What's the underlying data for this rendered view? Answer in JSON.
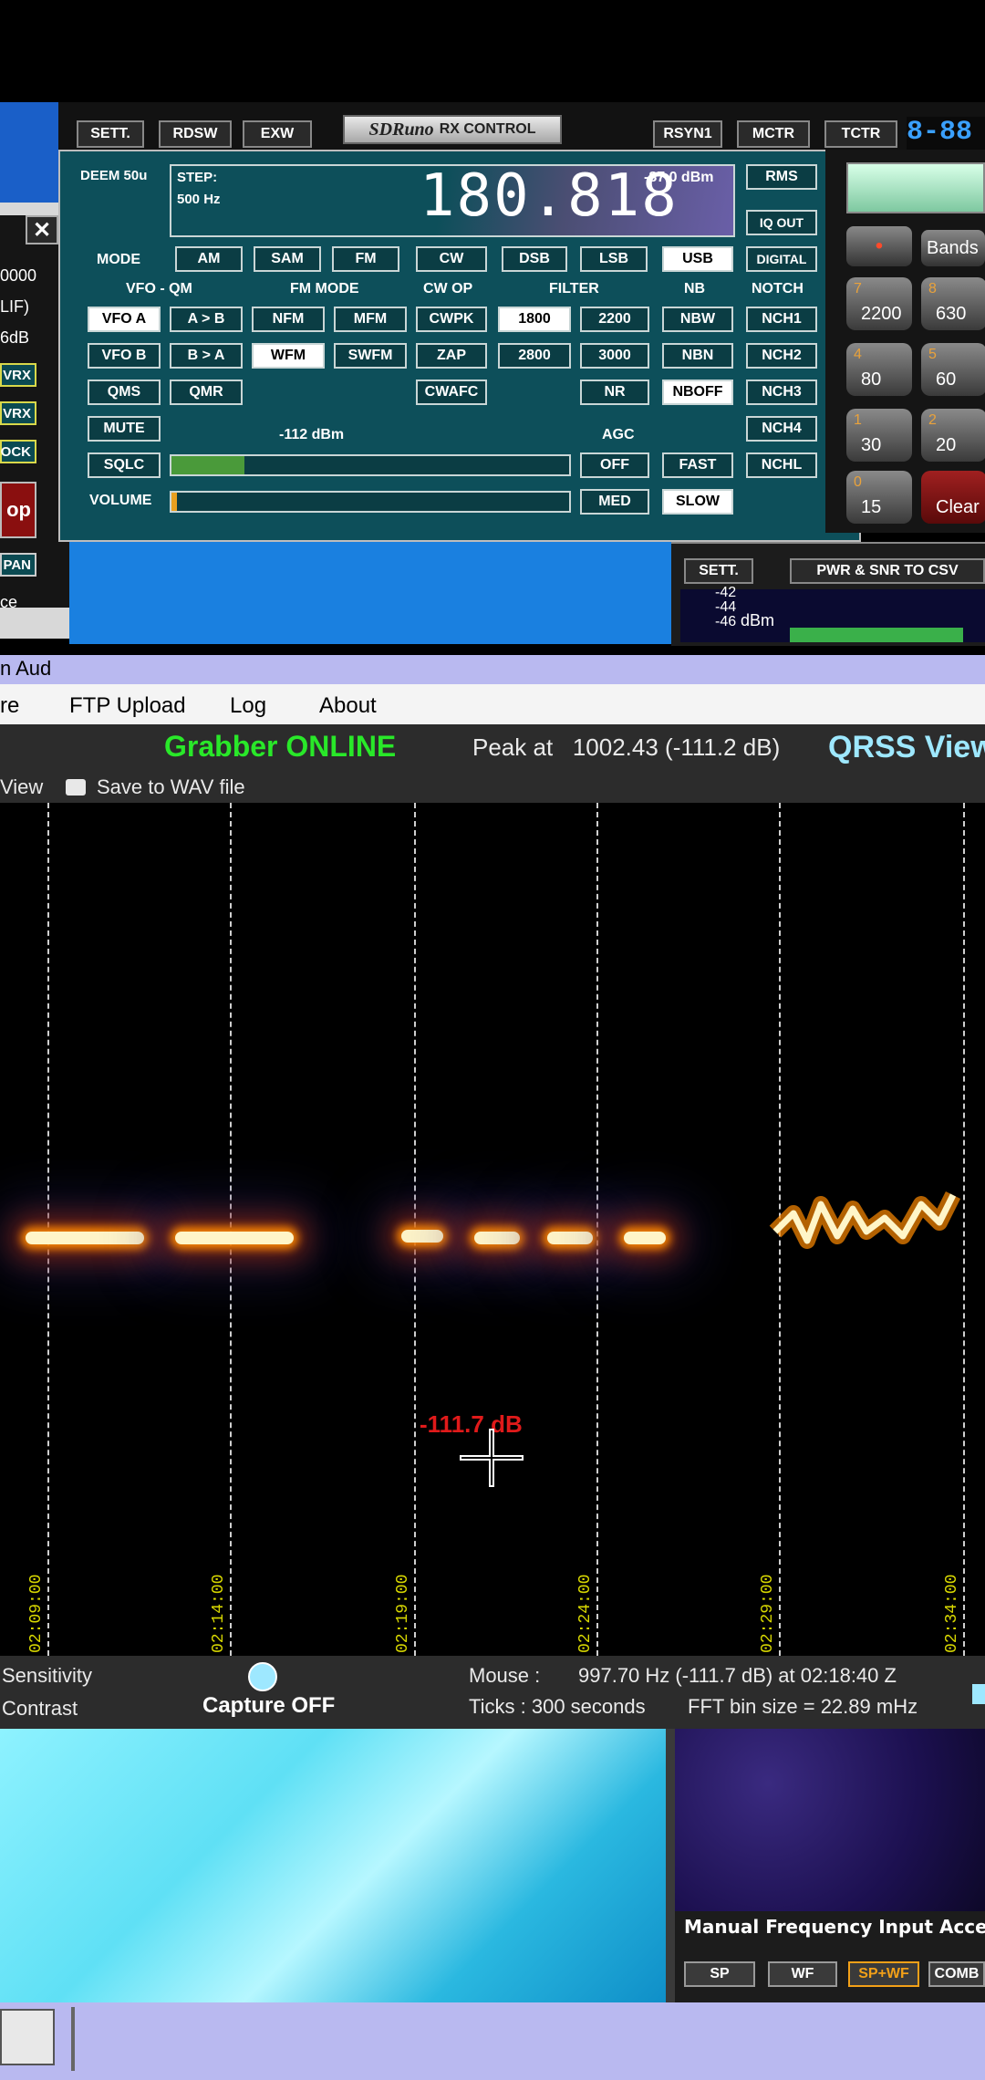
{
  "left_panel": {
    "items": [
      "0000",
      "LIF)",
      "6dB",
      "VRX",
      "VRX",
      "OCK",
      "op",
      "PAN",
      "ce"
    ],
    "close": "✕"
  },
  "sdr": {
    "top_buttons": [
      "SETT.",
      "RDSW",
      "EXW",
      "RSYN1",
      "MCTR",
      "TCTR"
    ],
    "logo": "SDRuno",
    "title": "RX CONTROL",
    "freq_readout_right": "8-88",
    "deem": "DEEM 50u",
    "step_label": "STEP:",
    "step_value": "500 Hz",
    "frequency": "180.818",
    "dbm": "-87.0 dBm",
    "rms": "RMS",
    "iq_out": "IQ OUT",
    "digital": "DIGITAL",
    "mode_label": "MODE",
    "modes": [
      "AM",
      "SAM",
      "FM",
      "CW",
      "DSB",
      "LSB",
      "USB"
    ],
    "section_labels": {
      "vfo": "VFO - QM",
      "fm_mode": "FM MODE",
      "cw_op": "CW OP",
      "filter": "FILTER",
      "nb": "NB",
      "notch": "NOTCH"
    },
    "row1": [
      "VFO A",
      "A > B",
      "NFM",
      "MFM",
      "CWPK",
      "1800",
      "2200",
      "NBW",
      "NCH1"
    ],
    "row2": [
      "VFO B",
      "B > A",
      "WFM",
      "SWFM",
      "ZAP",
      "2800",
      "3000",
      "NBN",
      "NCH2"
    ],
    "row3": [
      "QMS",
      "QMR",
      "CWAFC",
      "NR",
      "NBOFF",
      "NCH3"
    ],
    "row4": [
      "MUTE",
      "NCH4"
    ],
    "signal_level": "-112 dBm",
    "agc_label": "AGC",
    "sqlc": "SQLC",
    "agc1": [
      "OFF",
      "FAST",
      "NCHL"
    ],
    "volume": "VOLUME",
    "agc2": [
      "MED",
      "SLOW"
    ]
  },
  "keypad": {
    "keys": [
      {
        "n": "7",
        "v": "2200"
      },
      {
        "n": "8",
        "v": "630"
      },
      {
        "n": "4",
        "v": "80"
      },
      {
        "n": "5",
        "v": "60"
      },
      {
        "n": "1",
        "v": "30"
      },
      {
        "n": "2",
        "v": "20"
      },
      {
        "n": "0",
        "v": "15"
      },
      {
        "n": "",
        "v": "Clear"
      }
    ],
    "bands": "Bands"
  },
  "pwr": {
    "sett": "SETT.",
    "title": "PWR & SNR TO CSV",
    "scale": [
      "-42",
      "-44",
      "-46"
    ],
    "unit": "dBm"
  },
  "qrss": {
    "window_title": "n Aud",
    "menu": [
      "re",
      "FTP Upload",
      "Log",
      "About"
    ],
    "grabber": "Grabber ONLINE",
    "peak": "Peak at   1002.43 (-111.2 dB)",
    "brand": "QRSS View",
    "view": "View",
    "save_wav": "Save to WAV file",
    "cursor_label": "-111.7 dB",
    "ticks": [
      "02:09:00",
      "02:14:00",
      "02:19:00",
      "02:24:00",
      "02:29:00",
      "02:34:00"
    ],
    "sensitivity": "Sensitivity",
    "contrast": "Contrast",
    "capture": "Capture OFF",
    "mouse_label": "Mouse :",
    "mouse_value": "997.70 Hz  (-111.7 dB) at 02:18:40 Z",
    "ticks_label": "Ticks   : 300 seconds",
    "fft": "FFT bin size = 22.89 mHz"
  },
  "bottom": {
    "manual": "Manual Frequency Input Acce",
    "view_buttons": [
      "SP",
      "WF",
      "SP+WF",
      "COMB"
    ]
  }
}
